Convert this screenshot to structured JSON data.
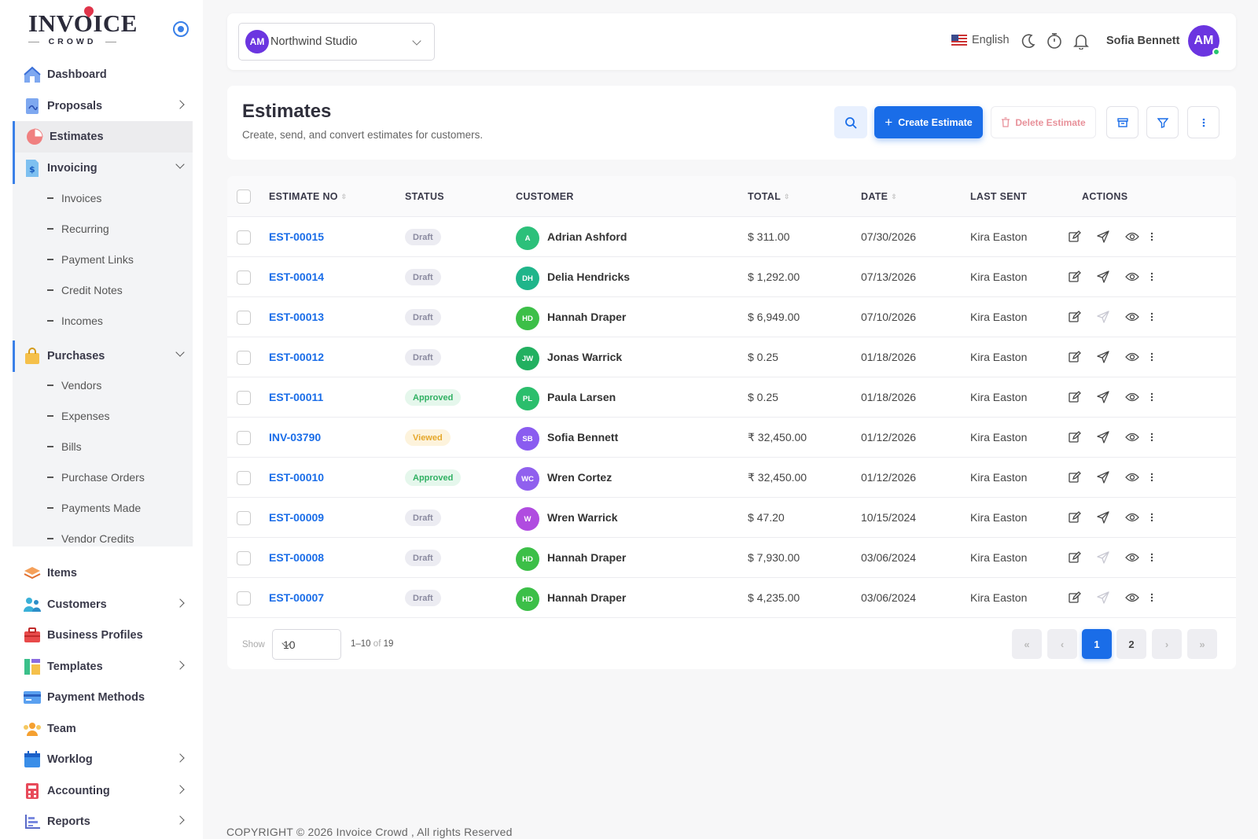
{
  "brand": {
    "name": "INVOICE",
    "tagline": "CROWD"
  },
  "sidebar": {
    "items": [
      {
        "label": "Dashboard",
        "icon": "home-icon"
      },
      {
        "label": "Proposals",
        "icon": "proposal-icon"
      },
      {
        "label": "Estimates",
        "icon": "pie-chart-icon"
      },
      {
        "label": "Invoicing",
        "icon": "invoice-icon"
      },
      {
        "label": "Purchases",
        "icon": "shopping-bag-icon"
      },
      {
        "label": "Items",
        "icon": "layers-icon"
      },
      {
        "label": "Customers",
        "icon": "users-icon"
      },
      {
        "label": "Business Profiles",
        "icon": "briefcase-icon"
      },
      {
        "label": "Templates",
        "icon": "templates-icon"
      },
      {
        "label": "Payment Methods",
        "icon": "credit-card-icon"
      },
      {
        "label": "Team",
        "icon": "team-icon"
      },
      {
        "label": "Worklog",
        "icon": "calendar-icon"
      },
      {
        "label": "Accounting",
        "icon": "calculator-icon"
      },
      {
        "label": "Reports",
        "icon": "bar-chart-icon"
      }
    ],
    "invoicing_sub": [
      "Invoices",
      "Recurring",
      "Payment Links",
      "Credit Notes",
      "Incomes"
    ],
    "purchases_sub": [
      "Vendors",
      "Expenses",
      "Bills",
      "Purchase Orders",
      "Payments Made",
      "Vendor Credits"
    ]
  },
  "topbar": {
    "org_initials": "AM",
    "org_name": "Northwind Studio",
    "language": "English",
    "user_name": "Sofia Bennett",
    "user_initials": "AM"
  },
  "header": {
    "title": "Estimates",
    "subtitle": "Create, send, and convert estimates for customers.",
    "create_label": "Create Estimate",
    "delete_label": "Delete Estimate"
  },
  "table": {
    "columns": [
      "ESTIMATE NO",
      "STATUS",
      "CUSTOMER",
      "TOTAL",
      "DATE",
      "LAST SENT",
      "ACTIONS"
    ],
    "rows": [
      {
        "no": "EST-00015",
        "status": "Draft",
        "initials": "A",
        "customer": "Adrian Ashford",
        "total": "$ 311.00",
        "date": "07/30/2026",
        "last_sent": "Kira Easton"
      },
      {
        "no": "EST-00014",
        "status": "Draft",
        "initials": "DH",
        "customer": "Delia Hendricks",
        "total": "$ 1,292.00",
        "date": "07/13/2026",
        "last_sent": "Kira Easton"
      },
      {
        "no": "EST-00013",
        "status": "Draft",
        "initials": "HD",
        "customer": "Hannah Draper",
        "total": "$ 6,949.00",
        "date": "07/10/2026",
        "last_sent": "Kira Easton"
      },
      {
        "no": "EST-00012",
        "status": "Draft",
        "initials": "JW",
        "customer": "Jonas Warrick",
        "total": "$ 0.25",
        "date": "01/18/2026",
        "last_sent": "Kira Easton"
      },
      {
        "no": "EST-00011",
        "status": "Approved",
        "initials": "PL",
        "customer": "Paula Larsen",
        "total": "$ 0.25",
        "date": "01/18/2026",
        "last_sent": "Kira Easton"
      },
      {
        "no": "INV-03790",
        "status": "Viewed",
        "initials": "SB",
        "customer": "Sofia Bennett",
        "total": "₹ 32,450.00",
        "date": "01/12/2026",
        "last_sent": "Kira Easton"
      },
      {
        "no": "EST-00010",
        "status": "Approved",
        "initials": "WC",
        "customer": "Wren Cortez",
        "total": "₹ 32,450.00",
        "date": "01/12/2026",
        "last_sent": "Kira Easton"
      },
      {
        "no": "EST-00009",
        "status": "Draft",
        "initials": "W",
        "customer": "Wren Warrick",
        "total": "$ 47.20",
        "date": "10/15/2024",
        "last_sent": "Kira Easton"
      },
      {
        "no": "EST-00008",
        "status": "Draft",
        "initials": "HD",
        "customer": "Hannah Draper",
        "total": "$ 7,930.00",
        "date": "03/06/2024",
        "last_sent": "Kira Easton"
      },
      {
        "no": "EST-00007",
        "status": "Draft",
        "initials": "HD",
        "customer": "Hannah Draper",
        "total": "$ 4,235.00",
        "date": "03/06/2024",
        "last_sent": "Kira Easton"
      }
    ]
  },
  "pagination": {
    "show_label": "Show",
    "page_size": "10",
    "range": "1–10",
    "of_label": "of",
    "total_count": "19",
    "pages": [
      "1",
      "2"
    ]
  },
  "footer": {
    "copyright": "COPYRIGHT © 2026 Invoice Crowd , All rights Reserved"
  },
  "colors": {
    "accent": "#1a6de8",
    "brand_purple": "#6b35e0",
    "draft": "#8a8aa0",
    "approved": "#2fb062",
    "viewed": "#e5a72a"
  }
}
